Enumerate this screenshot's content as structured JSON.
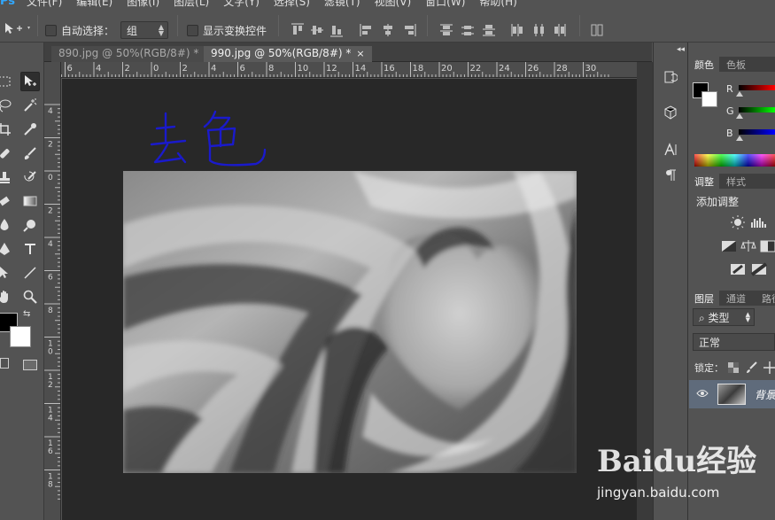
{
  "menubar": {
    "items": [
      "文件(F)",
      "编辑(E)",
      "图像(I)",
      "图层(L)",
      "文字(Y)",
      "选择(S)",
      "滤镜(T)",
      "视图(V)",
      "窗口(W)",
      "帮助(H)"
    ]
  },
  "options_bar": {
    "auto_select_label": "自动选择：",
    "auto_select_value": "组",
    "show_transform_label": "显示变换控件"
  },
  "tabs": [
    {
      "label": "890.jpg @ 50%(RGB/8#) *",
      "close": "×"
    },
    {
      "label": "990.jpg @ 50%(RGB/8#) *",
      "close": "×"
    }
  ],
  "ruler_h": [
    "8",
    "6",
    "4",
    "2",
    "0",
    "2",
    "4",
    "6",
    "8",
    "10",
    "12",
    "14",
    "16",
    "18",
    "20",
    "22",
    "24",
    "26",
    "28",
    "30"
  ],
  "ruler_v": [
    "4",
    "2",
    "0",
    "2",
    "4",
    "6",
    "8",
    "1\n0",
    "1\n2",
    "1\n4",
    "1\n6",
    "1\n8"
  ],
  "canvas": {
    "handwritten_note": "去色"
  },
  "color_panel": {
    "tabs": [
      "颜色",
      "色板"
    ],
    "channels": [
      "R",
      "G",
      "B"
    ],
    "foreground": "#000000",
    "background": "#ffffff"
  },
  "adjustments_panel": {
    "tabs": [
      "调整",
      "样式"
    ],
    "title": "添加调整"
  },
  "layers_panel": {
    "tabs": [
      "图层",
      "通道",
      "路径"
    ],
    "filter_type": "类型",
    "blend_mode": "正常",
    "lock_label": "锁定：",
    "layer_name": "背景"
  },
  "watermark": {
    "logo_text": "Baidu经验",
    "url": "jingyan.baidu.com"
  },
  "colors": {
    "ui_bg": "#535353",
    "canvas_bg": "#282828",
    "note_ink": "#1a1acc"
  }
}
